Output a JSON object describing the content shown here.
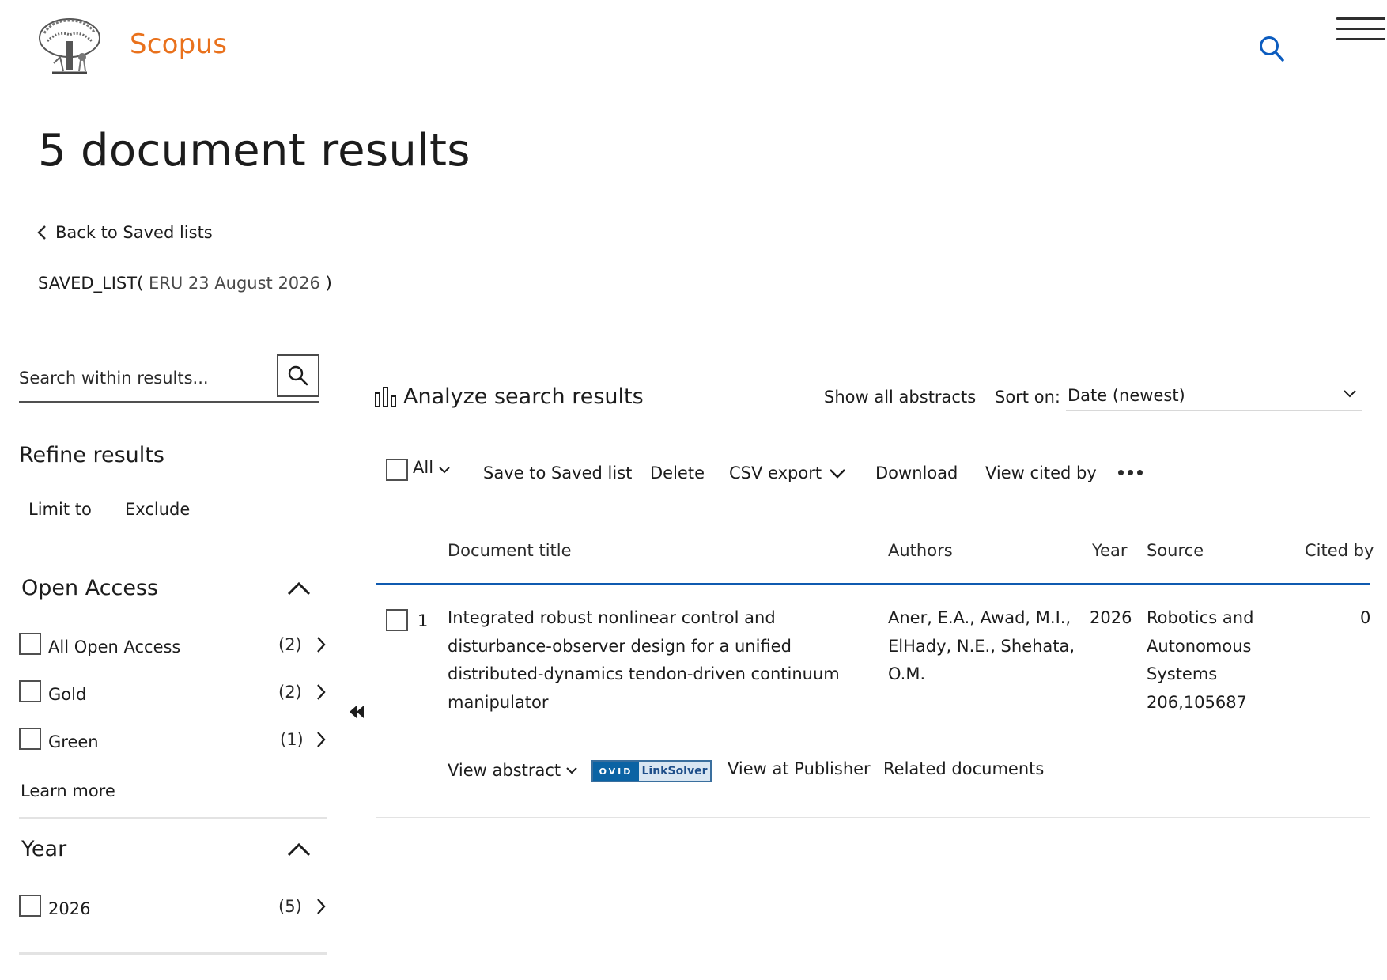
{
  "header": {
    "brand": "Scopus"
  },
  "page": {
    "title": "5 document results",
    "back_link": "Back to Saved lists",
    "saved_list_prefix": "SAVED_LIST(",
    "saved_list_name": " ERU 23 August 2026 ",
    "saved_list_suffix": ")"
  },
  "sidebar": {
    "search_placeholder": "Search within results...",
    "refine_title": "Refine results",
    "limit_to": "Limit to",
    "exclude": "Exclude",
    "open_access": {
      "title": "Open Access",
      "items": [
        {
          "label": "All Open Access",
          "count": "(2)"
        },
        {
          "label": "Gold",
          "count": "(2)"
        },
        {
          "label": "Green",
          "count": "(1)"
        }
      ],
      "learn_more": "Learn more"
    },
    "year": {
      "title": "Year",
      "items": [
        {
          "label": "2026",
          "count": "(5)"
        }
      ]
    }
  },
  "main": {
    "analyze": "Analyze search results",
    "show_all_abstracts": "Show all abstracts",
    "sort_on_label": "Sort on:",
    "sort_value": "Date (newest)",
    "toolbar": {
      "all": "All",
      "save_to_list": "Save to Saved list",
      "delete": "Delete",
      "csv_export": "CSV export",
      "download": "Download",
      "view_cited_by": "View cited by"
    },
    "columns": {
      "title": "Document title",
      "authors": "Authors",
      "year": "Year",
      "source": "Source",
      "cited_by": "Cited by"
    },
    "rows": [
      {
        "index": "1",
        "title_lines": [
          "Integrated robust nonlinear control and",
          "disturbance-observer design for a unified",
          "distributed-dynamics tendon-driven continuum",
          "manipulator"
        ],
        "author_lines": [
          "Aner, E.A., Awad, M.I.,",
          "ElHady, N.E., Shehata,",
          "O.M."
        ],
        "year": "2026",
        "source_lines": [
          "Robotics and",
          "Autonomous",
          "Systems",
          "206,105687"
        ],
        "cited_by": "0",
        "actions": {
          "view_abstract": "View abstract",
          "linksolver_ovid": "OVID",
          "linksolver_text": "LinkSolver",
          "view_at_publisher": "View at Publisher",
          "related_documents": "Related documents"
        }
      }
    ]
  },
  "colors": {
    "brand": "#e9711c",
    "accent": "#0f5ab0",
    "text": "#1c1c1c"
  }
}
